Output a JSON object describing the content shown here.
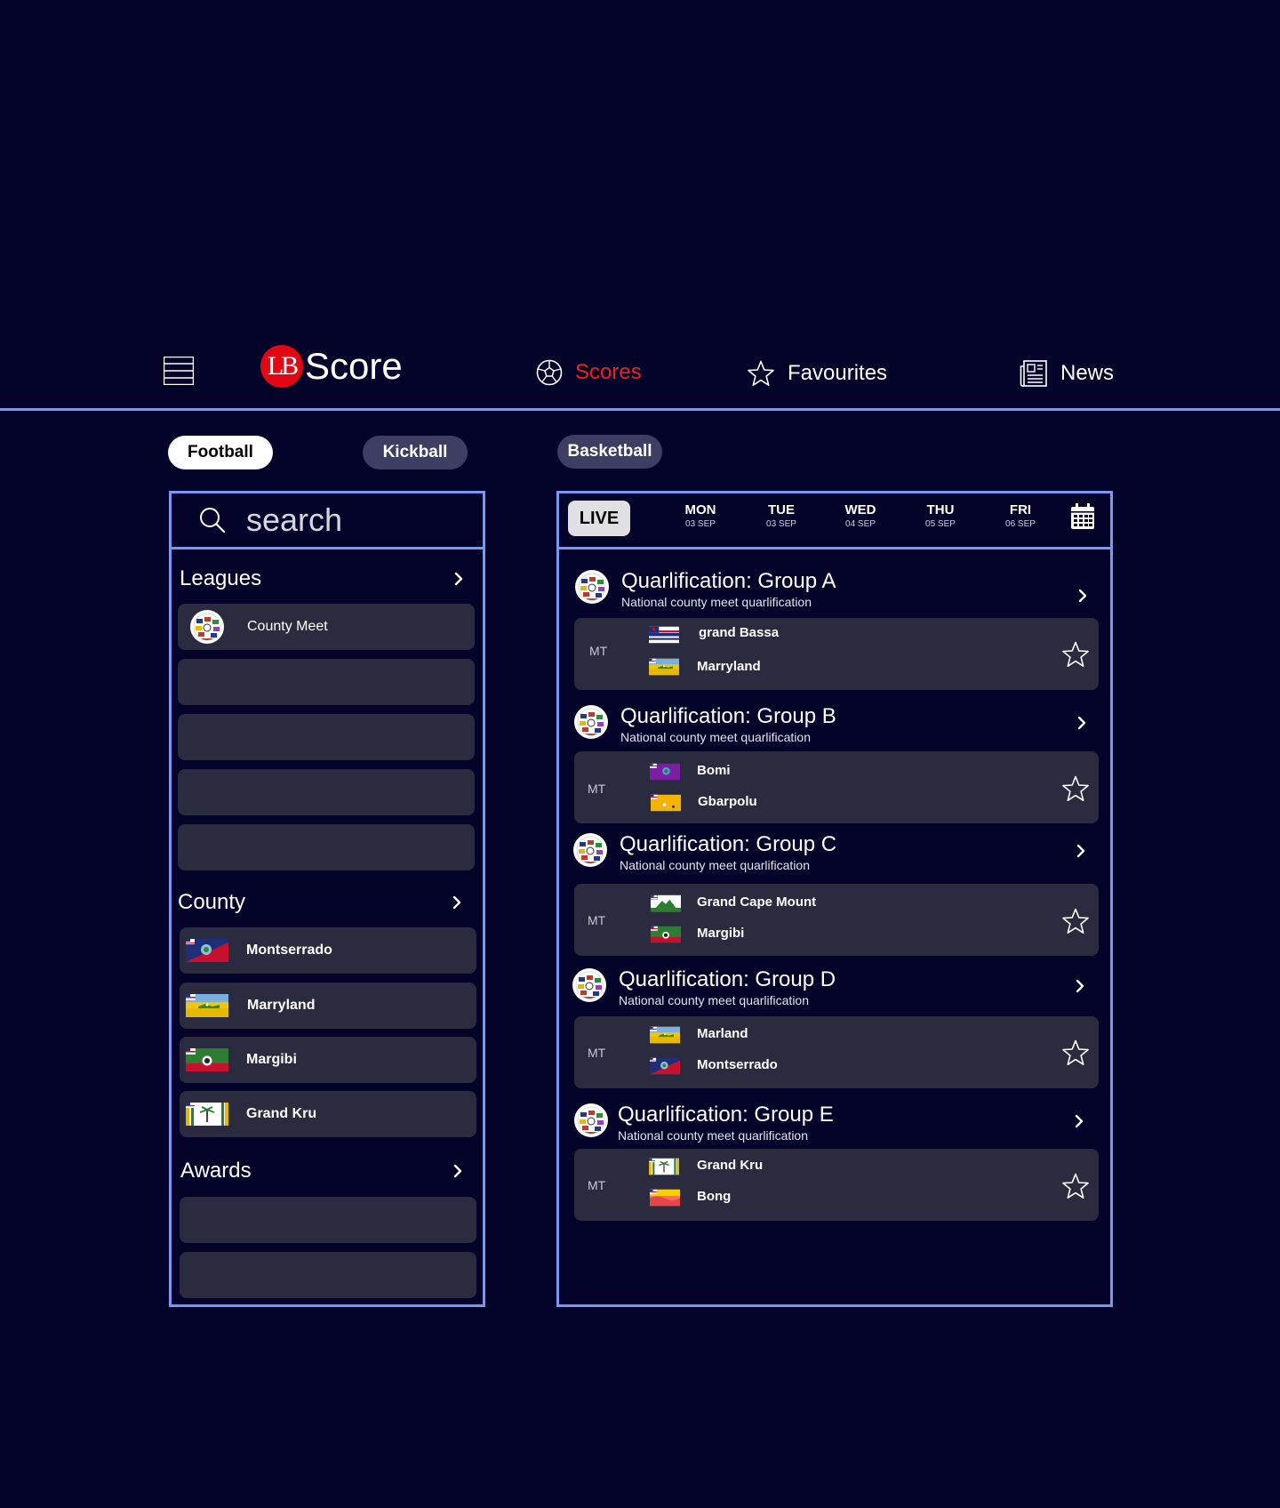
{
  "header": {
    "logo_badge": "LB",
    "logo_text": "Score",
    "nav": [
      {
        "label": "Scores",
        "icon": "soccer-ball-icon",
        "active": true
      },
      {
        "label": "Favourites",
        "icon": "star-icon",
        "active": false
      },
      {
        "label": "News",
        "icon": "newspaper-icon",
        "active": false
      }
    ]
  },
  "sports": [
    {
      "label": "Football",
      "active": true
    },
    {
      "label": "Kickball",
      "active": false
    },
    {
      "label": "Basketball",
      "active": false
    }
  ],
  "sidebar": {
    "search_placeholder": "search",
    "leagues": {
      "title": "Leagues",
      "items": [
        "County Meet",
        "",
        "",
        "",
        ""
      ]
    },
    "county": {
      "title": "County",
      "items": [
        "Montserrado",
        "Marryland",
        "Margibi",
        "Grand Kru"
      ]
    },
    "awards": {
      "title": "Awards",
      "items": [
        "",
        ""
      ]
    }
  },
  "schedule": {
    "live_label": "LIVE",
    "days": [
      {
        "name": "MON",
        "date": "03 SEP"
      },
      {
        "name": "TUE",
        "date": "03 SEP"
      },
      {
        "name": "WED",
        "date": "04 SEP"
      },
      {
        "name": "THU",
        "date": "05 SEP"
      },
      {
        "name": "FRI",
        "date": "06 SEP"
      }
    ]
  },
  "groups": [
    {
      "title": "Quarlification: Group A",
      "subtitle": "National county meet quarlification",
      "status": "MT",
      "home": "grand Bassa",
      "away": "Marryland"
    },
    {
      "title": "Quarlification: Group B",
      "subtitle": "National county meet quarlification",
      "status": "MT",
      "home": "Bomi",
      "away": "Gbarpolu"
    },
    {
      "title": "Quarlification: Group C",
      "subtitle": "National county meet quarlification",
      "status": "MT",
      "home": "Grand Cape Mount",
      "away": "Margibi"
    },
    {
      "title": "Quarlification: Group D",
      "subtitle": "National county meet quarlification",
      "status": "MT",
      "home": "Marland",
      "away": "Montserrado"
    },
    {
      "title": "Quarlification: Group E",
      "subtitle": "National county meet quarlification",
      "status": "MT",
      "home": "Grand Kru",
      "away": "Bong"
    }
  ],
  "colors": {
    "background": "#04032a",
    "accent": "#e8232a",
    "border": "#7a97f2",
    "card": "#2b2b40",
    "pill_inactive": "#3e3d63"
  }
}
